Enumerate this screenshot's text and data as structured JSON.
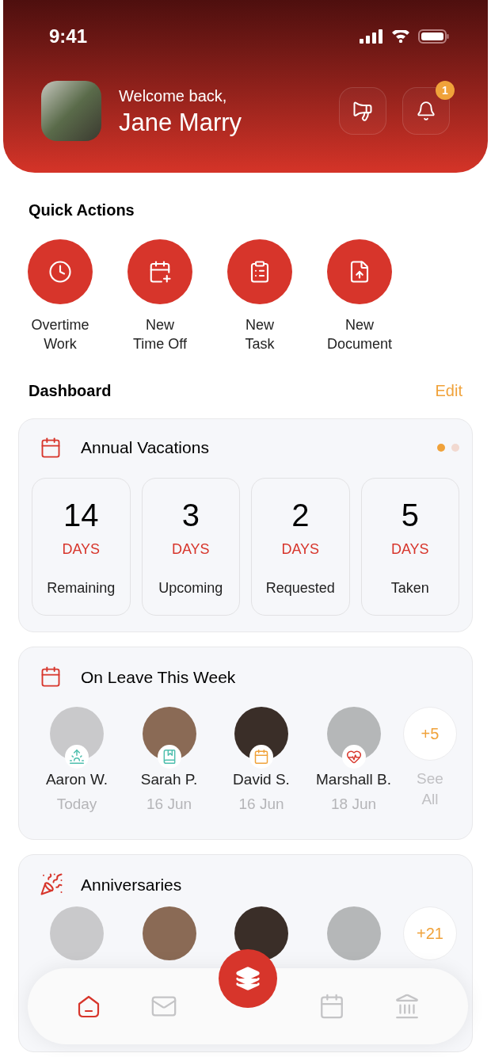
{
  "status_bar": {
    "time": "9:41"
  },
  "header": {
    "greeting": "Welcome back,",
    "name": "Jane Marry",
    "notification_count": "1"
  },
  "quick_actions": {
    "title": "Quick Actions",
    "items": [
      {
        "kind": "clock",
        "label": "Overtime\nWork"
      },
      {
        "kind": "calendar-plus",
        "label": "New\nTime Off"
      },
      {
        "kind": "clipboard",
        "label": "New\nTask"
      },
      {
        "kind": "file-upload",
        "label": "New\nDocument"
      }
    ]
  },
  "dashboard": {
    "title": "Dashboard",
    "edit": "Edit"
  },
  "annual_vacations": {
    "title": "Annual Vacations",
    "pages": [
      {
        "selected": true
      },
      {
        "selected": false
      }
    ],
    "stats": [
      {
        "value": "14",
        "unit": "DAYS",
        "label": "Remaining"
      },
      {
        "value": "3",
        "unit": "DAYS",
        "label": "Upcoming"
      },
      {
        "value": "2",
        "unit": "DAYS",
        "label": "Requested"
      },
      {
        "value": "5",
        "unit": "DAYS",
        "label": "Taken"
      }
    ]
  },
  "on_leave": {
    "title": "On Leave This Week",
    "people": [
      {
        "name": "Aaron W.",
        "date": "Today",
        "kind": "sun",
        "color": "#4fbfae"
      },
      {
        "name": "Sarah P.",
        "date": "16 Jun",
        "kind": "book",
        "color": "#4fbfae"
      },
      {
        "name": "David S.",
        "date": "16 Jun",
        "kind": "calendar",
        "color": "#f0a23a"
      },
      {
        "name": "Marshall B.",
        "date": "18 Jun",
        "kind": "heart",
        "color": "#d93a2f"
      }
    ],
    "more": "+5",
    "see_all": "See\nAll"
  },
  "anniversaries": {
    "title": "Anniversaries",
    "more": "+21"
  },
  "bottom_nav": {
    "items": [
      {
        "kind": "home",
        "selected": true
      },
      {
        "kind": "mail",
        "selected": false
      },
      {
        "kind": "layers",
        "selected": false
      },
      {
        "kind": "calendar",
        "selected": false
      },
      {
        "kind": "bank",
        "selected": false
      }
    ]
  }
}
